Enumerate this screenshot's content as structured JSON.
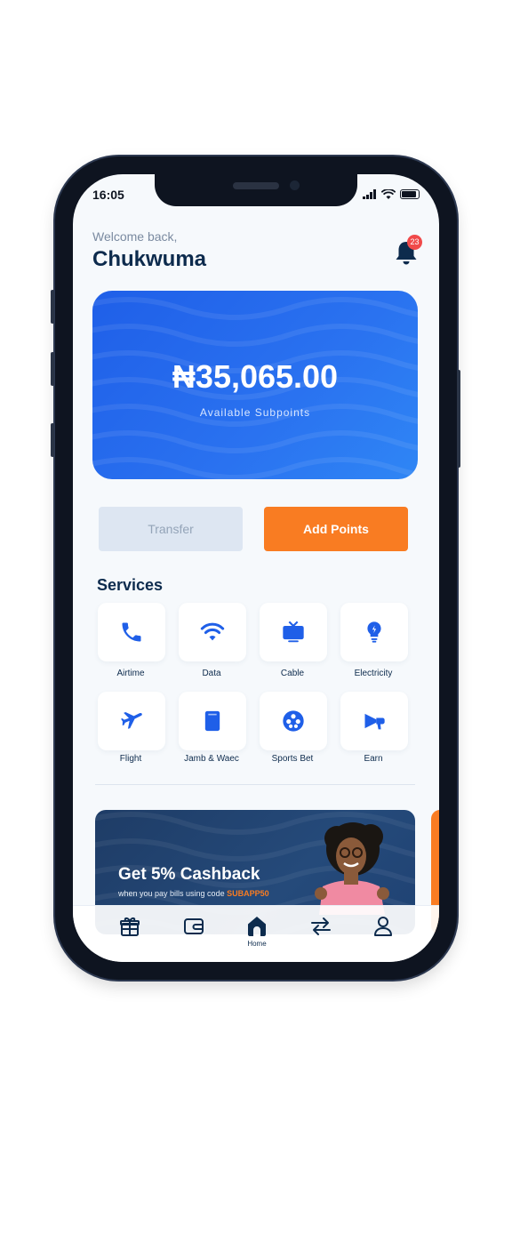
{
  "status_bar": {
    "time": "16:05"
  },
  "header": {
    "greeting": "Welcome back,",
    "username": "Chukwuma",
    "notification_count": "23"
  },
  "balance": {
    "amount": "₦35,065.00",
    "label": "Available Subpoints"
  },
  "actions": {
    "transfer_label": "Transfer",
    "add_points_label": "Add Points"
  },
  "services": {
    "title": "Services",
    "items": [
      {
        "label": "Airtime",
        "icon": "phone-icon"
      },
      {
        "label": "Data",
        "icon": "wifi-icon"
      },
      {
        "label": "Cable",
        "icon": "tv-icon"
      },
      {
        "label": "Electricity",
        "icon": "lightbulb-icon"
      },
      {
        "label": "Flight",
        "icon": "airplane-icon"
      },
      {
        "label": "Jamb & Waec",
        "icon": "book-icon"
      },
      {
        "label": "Sports Bet",
        "icon": "soccer-ball-icon"
      },
      {
        "label": "Earn",
        "icon": "megaphone-icon"
      }
    ]
  },
  "promo": {
    "title": "Get 5% Cashback",
    "subtitle": "when you pay bills using code",
    "code": "SUBAPP50"
  },
  "tabbar": {
    "items": [
      {
        "icon": "gift-icon",
        "label": ""
      },
      {
        "icon": "wallet-icon",
        "label": ""
      },
      {
        "icon": "home-icon",
        "label": "Home",
        "active": true
      },
      {
        "icon": "transfer-arrows-icon",
        "label": ""
      },
      {
        "icon": "profile-icon",
        "label": ""
      }
    ]
  },
  "colors": {
    "primary_blue": "#1f5fe8",
    "accent_orange": "#f97c22",
    "navy": "#0d2b4d",
    "badge_red": "#f04a4a"
  }
}
